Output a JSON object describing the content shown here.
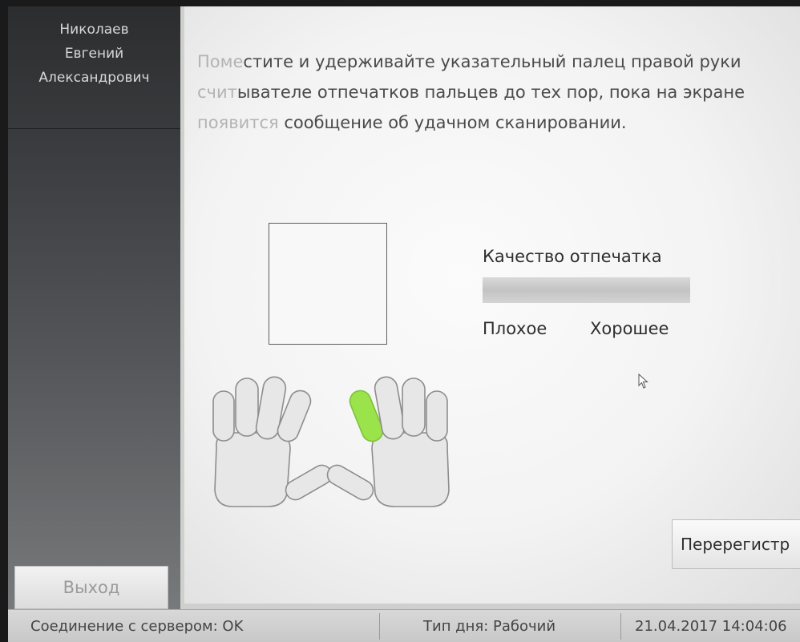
{
  "sidebar": {
    "user": {
      "last_name": "Николаев",
      "first_name": "Евгений",
      "patronymic": "Александрович"
    },
    "exit_label": "Выход"
  },
  "main": {
    "instruction_lines": [
      [
        "Поме",
        "стите и удерживайте указательный палец правой руки"
      ],
      [
        "счит",
        "ывателе отпечатков пальцев до тех пор, пока на экране"
      ],
      [
        "появится",
        " сообщение об удачном сканировании."
      ]
    ],
    "quality": {
      "label": "Качество отпечатка",
      "bad_label": "Плохое",
      "good_label": "Хорошее",
      "level": 0
    },
    "hands": {
      "active_finger": "right-index",
      "active_color": "#9be34a"
    },
    "reregister_label": "Перерегистр"
  },
  "statusbar": {
    "connection": "Соединение с сервером: OK",
    "day_type": "Тип дня: Рабочий",
    "datetime": "21.04.2017 14:04:06"
  }
}
